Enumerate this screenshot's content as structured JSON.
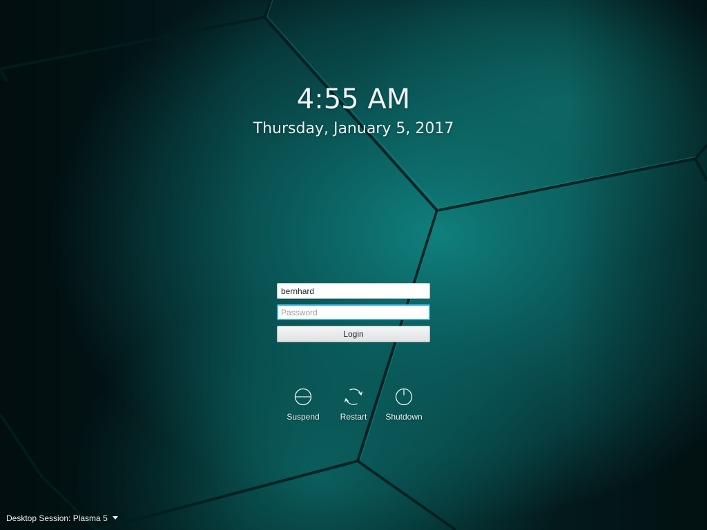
{
  "clock": {
    "time": "4:55 AM",
    "date": "Thursday, January 5, 2017"
  },
  "login": {
    "username_value": "bernhard",
    "password_placeholder": "Password",
    "login_label": "Login"
  },
  "actions": [
    {
      "label": "Suspend",
      "icon": "suspend-icon"
    },
    {
      "label": "Restart",
      "icon": "restart-icon"
    },
    {
      "label": "Shutdown",
      "icon": "shutdown-icon"
    }
  ],
  "session": {
    "label": "Desktop Session: Plasma 5",
    "icon": "chevron-down-icon"
  },
  "colors": {
    "background_dark": "#06292a",
    "background_glow": "#0f8a86",
    "text": "#eef3f3",
    "focus_accent": "#3daee9"
  }
}
